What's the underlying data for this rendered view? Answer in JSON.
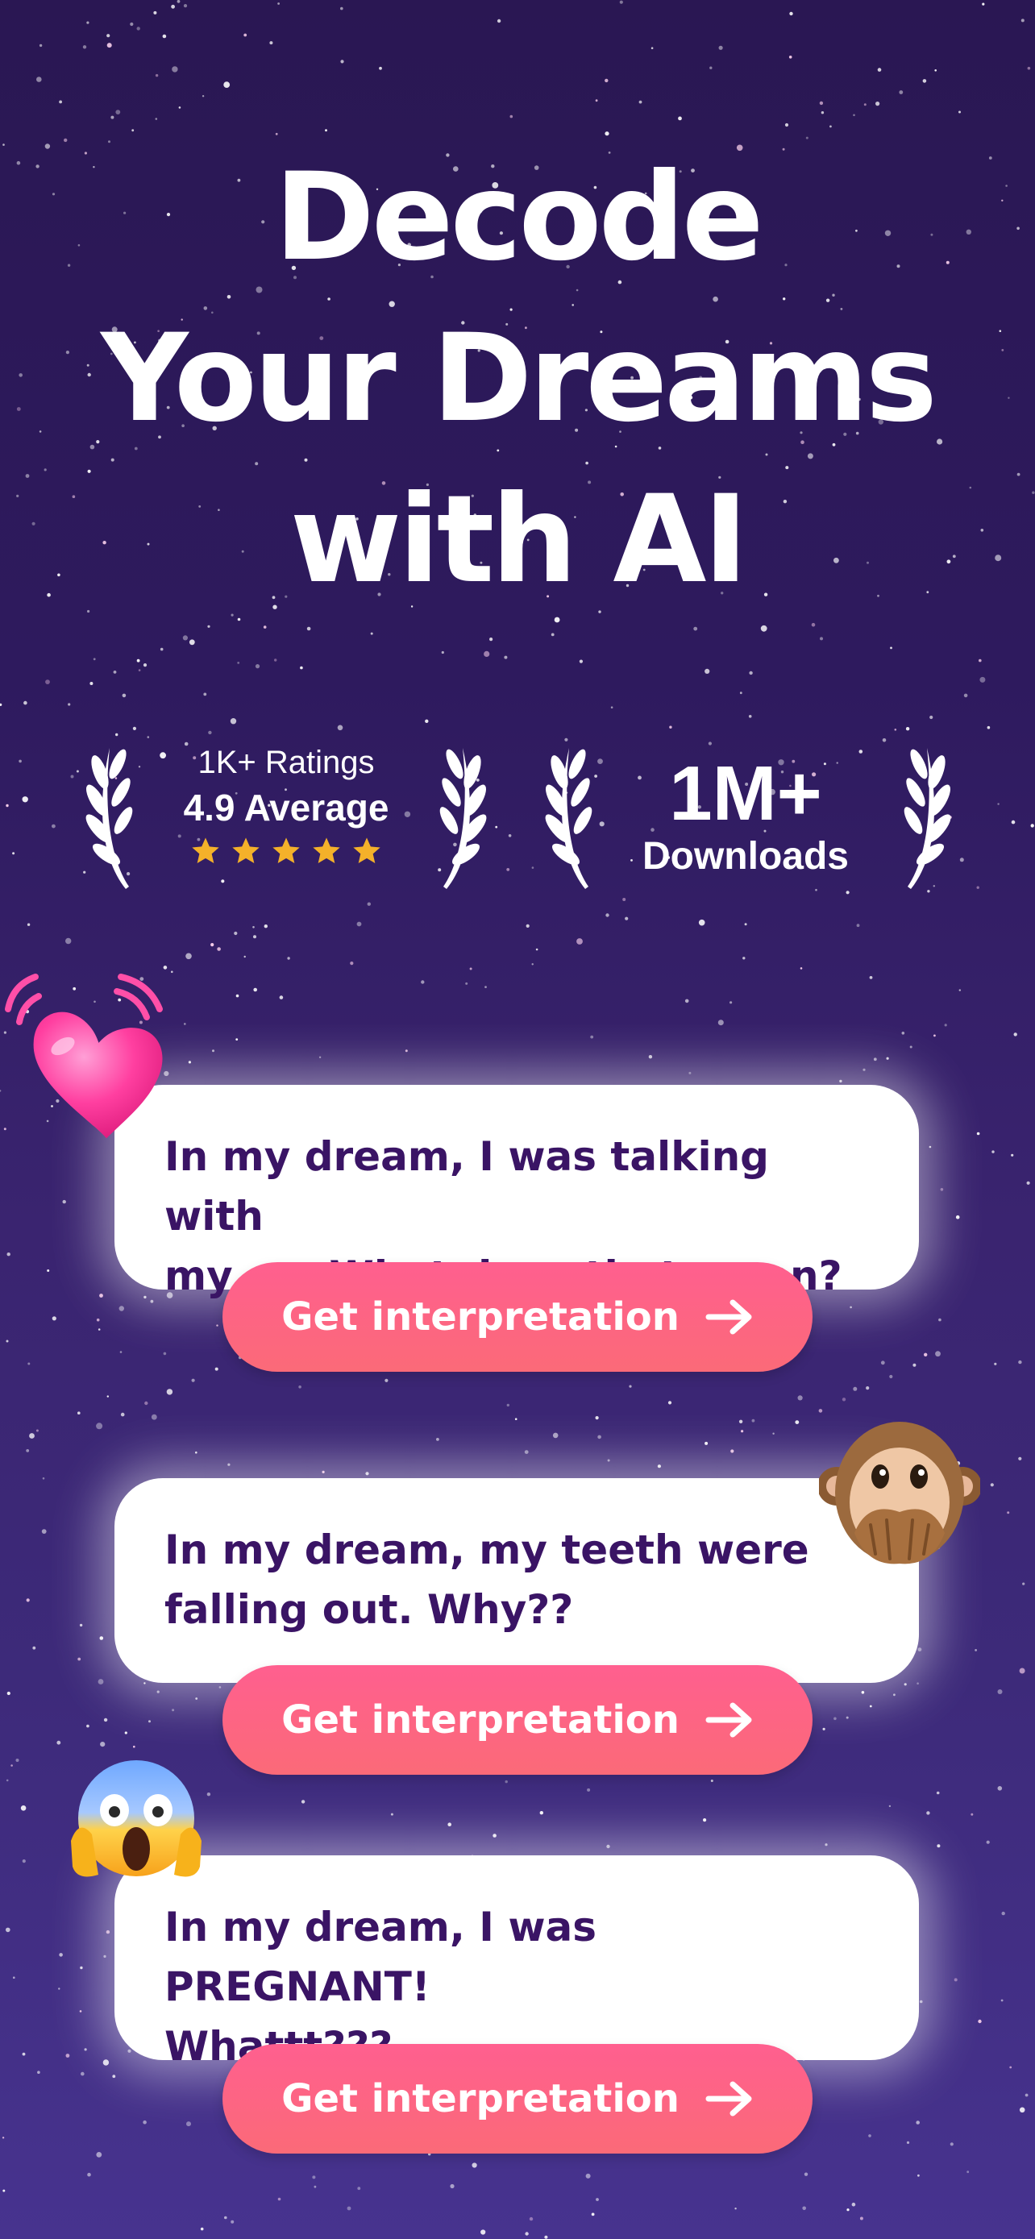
{
  "headline": {
    "line1": "Decode",
    "line2": "Your Dreams",
    "line3": "with AI"
  },
  "ratings": {
    "count_label": "1K+ Ratings",
    "average_label": "4.9 Average",
    "stars": 5,
    "star_color": "#f4b12a"
  },
  "downloads": {
    "number": "1M+",
    "label": "Downloads"
  },
  "cards": [
    {
      "text": "In my dream, I was talking with\nmy ex. What does that mean?",
      "button_label": "Get interpretation",
      "emoji": "heart-emoji"
    },
    {
      "text": "In my dream, my teeth were\nfalling out. Why??",
      "button_label": "Get interpretation",
      "emoji": "monkey-emoji"
    },
    {
      "text": "In my dream, I was PREGNANT!\nWhattt???",
      "button_label": "Get interpretation",
      "emoji": "screaming-face-emoji"
    }
  ],
  "colors": {
    "background": "#2e1a5e",
    "card_text": "#3a1465",
    "button": "#ff5f8f"
  }
}
